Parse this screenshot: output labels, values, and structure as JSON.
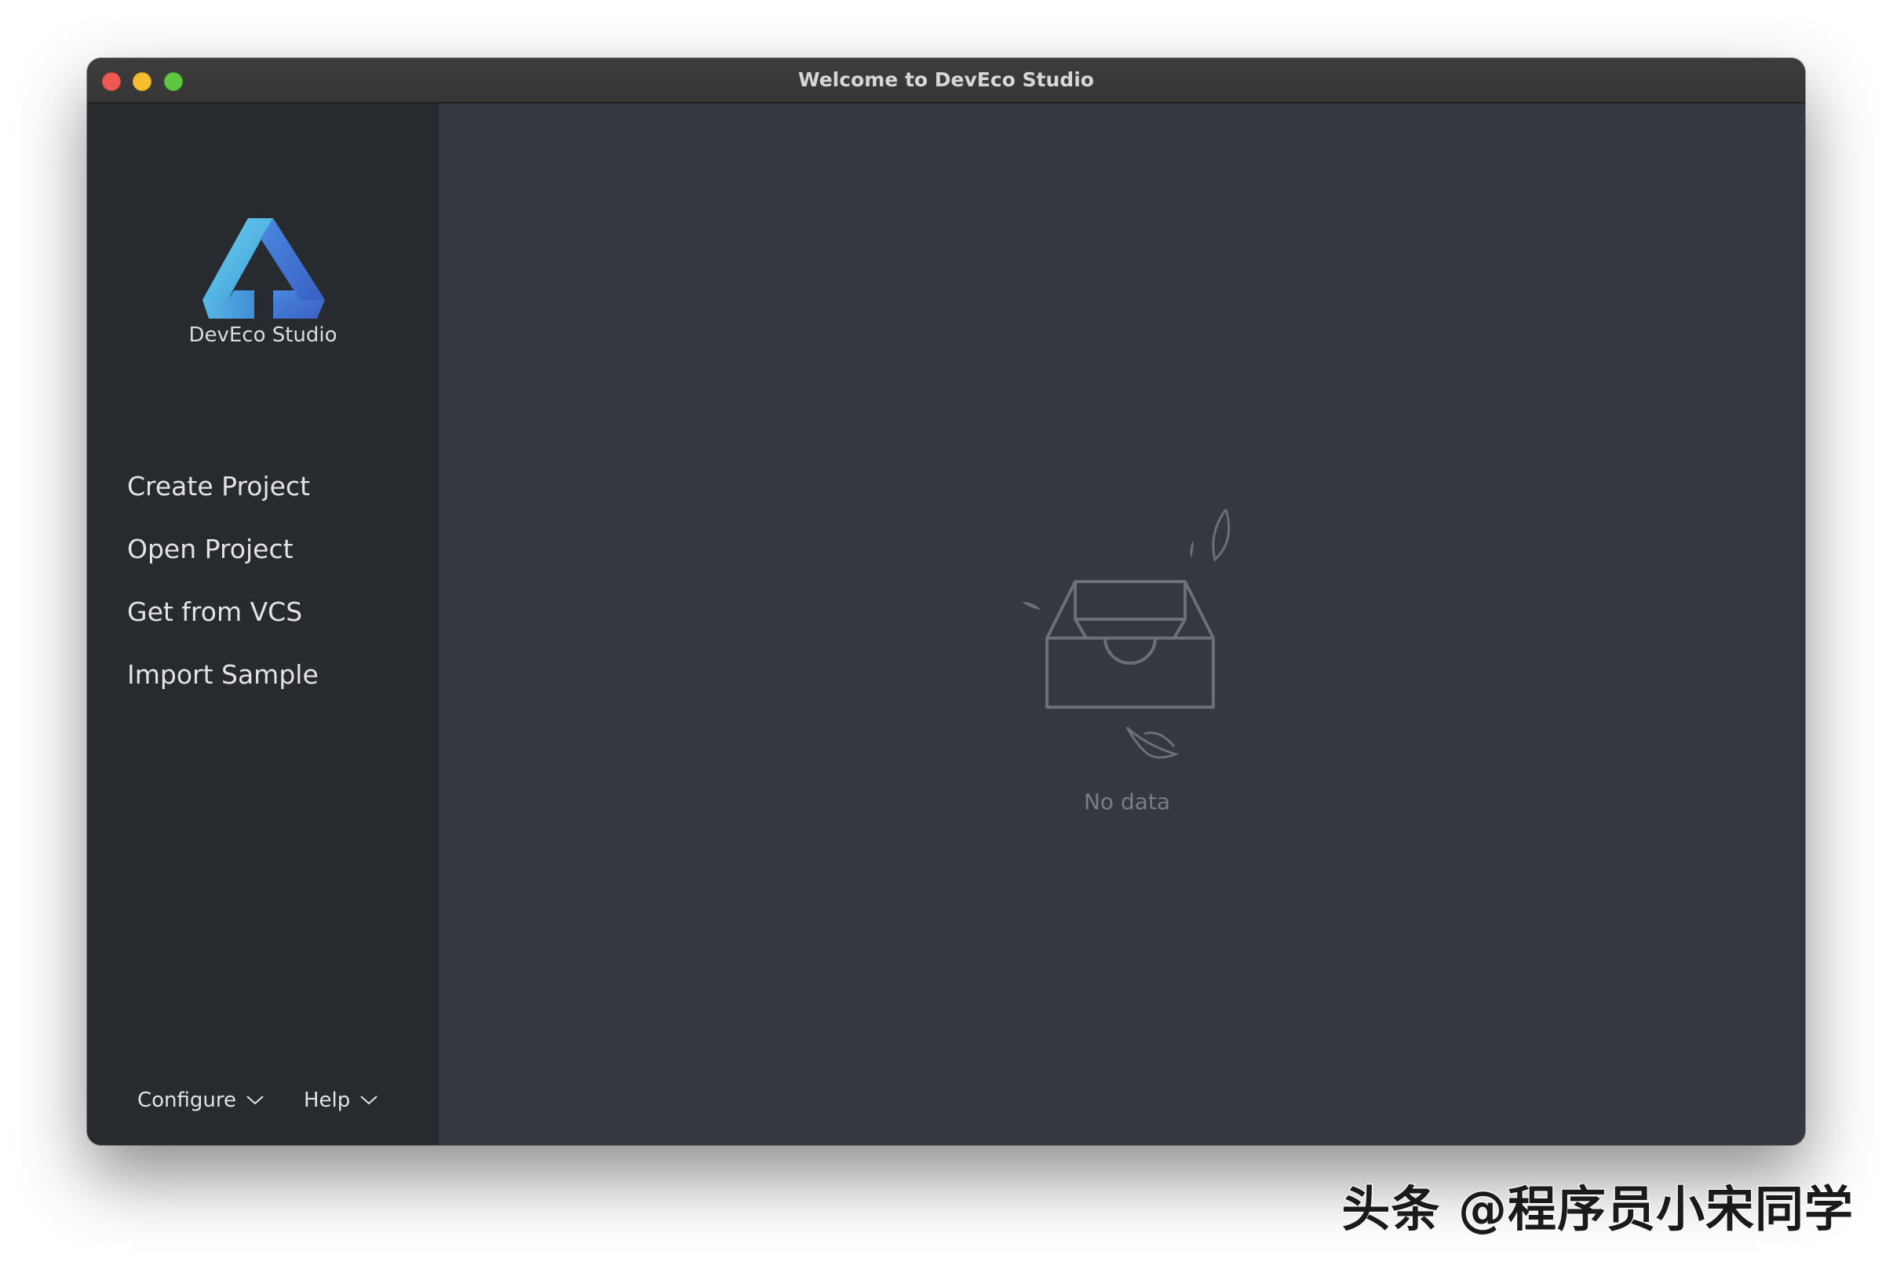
{
  "window": {
    "title": "Welcome to DevEco Studio"
  },
  "sidebar": {
    "logo_icon": "deveco-logo-icon",
    "product_name": "DevEco Studio",
    "items": [
      {
        "label": "Create Project"
      },
      {
        "label": "Open Project"
      },
      {
        "label": "Get from VCS"
      },
      {
        "label": "Import Sample"
      }
    ],
    "footer": {
      "configure_label": "Configure",
      "help_label": "Help"
    }
  },
  "main": {
    "empty_icon": "empty-inbox-icon",
    "empty_text": "No data"
  },
  "watermark": {
    "text": "头条 @程序员小宋同学"
  },
  "colors": {
    "sidebar_bg": "#272a2f",
    "main_bg": "#353840",
    "titlebar_bg": "#3a3a3a",
    "logo_light": "#5fc6e8",
    "logo_dark": "#3f6fd1"
  }
}
